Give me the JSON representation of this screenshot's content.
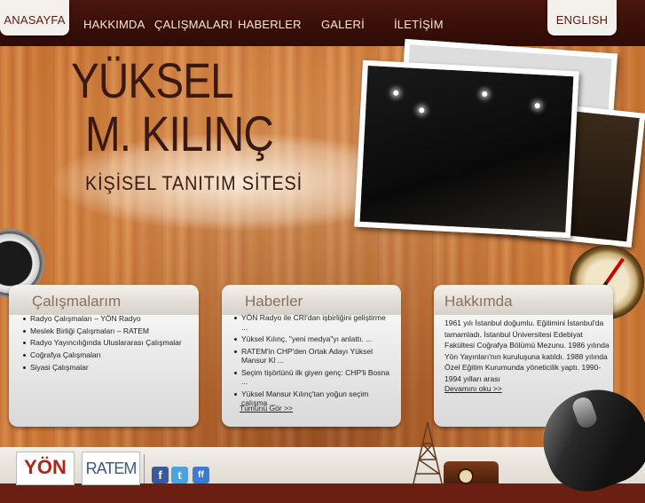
{
  "nav": {
    "items": [
      "ANASAYFA",
      "HAKKIMDA",
      "ÇALIŞMALARI",
      "HABERLER",
      "GALERİ",
      "İLETİŞİM"
    ],
    "active": "ANASAYFA",
    "lang": "ENGLISH"
  },
  "header": {
    "name_line1": "YÜKSEL",
    "name_line2": "M. KILINÇ",
    "subtitle": "KİŞİSEL TANITIM SİTESİ"
  },
  "works": {
    "title": "Çalışmalarım",
    "items": [
      "Radyo Çalışmaları – YÖN Radyo",
      "Meslek Birliği Çalışmaları – RATEM",
      "Radyo Yayıncılığında Uluslararası Çalışmalar",
      "Coğrafya Çalışmaları",
      "Siyasi Çalışmalar"
    ]
  },
  "news": {
    "title": "Haberler",
    "items": [
      "YÖN Radyo ile CRI'dan işbirliğini geliştirme ...",
      "Yüksel Kılınç, \"yeni medya\"yı anlattı. ...",
      "RATEM'in CHP'den Ortak Adayı Yüksel Mansur Kl ...",
      "Seçim tişörtünü ilk giyen genç: CHP'li Bosna ...",
      "Yüksel Mansur Kılınç'tan yoğun seçim çalışma ..."
    ],
    "all_link": "Tümünü Gör >>"
  },
  "about": {
    "title": "Hakkımda",
    "text": "1961 yılı İstanbul doğumlu. Eğitimini İstanbul'da tamamladı. İstanbul Üniversitesi Edebiyat Fakültesi Coğrafya Bölümü Mezunu. 1986 yılında Yön Yayınları'nın kuruluşuna katıldı. 1988 yılında Özel Eğitim Kurumunda yöneticilik yaptı. 1990-1994 yılları arası",
    "more_link": "Devamını oku >>"
  },
  "footer": {
    "logo_yon": "YÖN",
    "logo_ratem": "RATEM",
    "social": [
      "f",
      "t",
      "ff"
    ]
  },
  "colors": {
    "header_bg": "#2e0b07",
    "wood": "#c9753a",
    "text_dark": "#3a1a10",
    "panel_title": "#8a6f60"
  }
}
